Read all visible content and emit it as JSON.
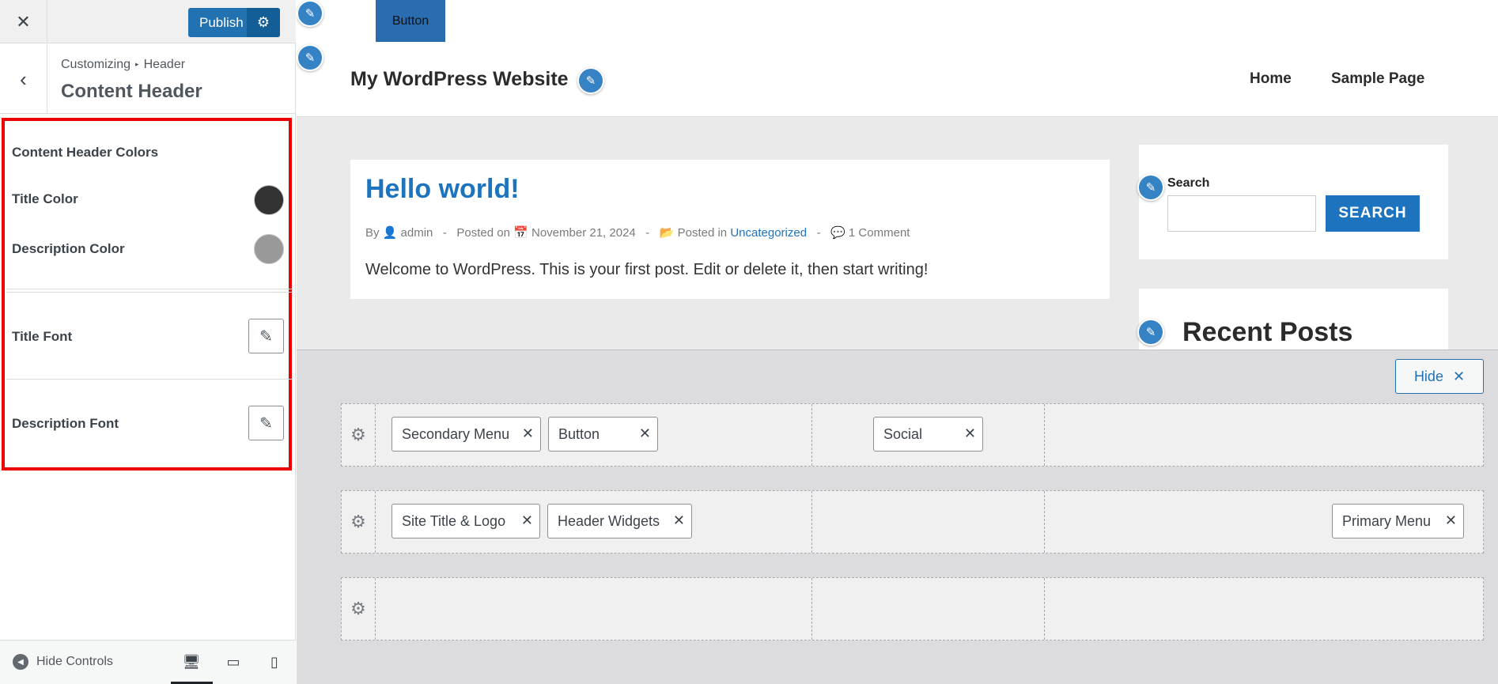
{
  "sidebar": {
    "close_icon": "close-icon",
    "publish_label": "Publish",
    "breadcrumb": {
      "root": "Customizing",
      "separator": "▸",
      "current": "Header"
    },
    "title": "Content Header",
    "section_title": "Content Header Colors",
    "controls": {
      "title_color_label": "Title Color",
      "title_color_value": "#333333",
      "description_color_label": "Description Color",
      "description_color_value": "#999999",
      "title_font_label": "Title Font",
      "description_font_label": "Description Font"
    },
    "footer": {
      "hide_controls_label": "Hide Controls",
      "devices": [
        "desktop",
        "tablet",
        "mobile"
      ],
      "active_device": "desktop"
    }
  },
  "preview": {
    "top_button_label": "Button",
    "site_title": "My WordPress Website",
    "nav": [
      "Home",
      "Sample Page"
    ],
    "post": {
      "title": "Hello world!",
      "meta": {
        "by": "By",
        "author": "admin",
        "posted_on": "Posted on",
        "date": "November 21, 2024",
        "posted_in": "Posted in",
        "category": "Uncategorized",
        "comments": "1 Comment"
      },
      "excerpt": "Welcome to WordPress. This is your first post. Edit or delete it, then start writing!"
    },
    "search_widget": {
      "label": "Search",
      "button_label": "SEARCH",
      "input_value": ""
    },
    "recent_posts_title": "Recent Posts"
  },
  "builder": {
    "hide_label": "Hide",
    "rows": [
      {
        "items_left": [
          "Secondary Menu",
          "Button"
        ],
        "items_center": [
          "Social"
        ],
        "items_right": []
      },
      {
        "items_left": [
          "Site Title & Logo",
          "Header Widgets"
        ],
        "items_center": [],
        "items_right": [
          "Primary Menu"
        ]
      },
      {
        "items_left": [],
        "items_center": [],
        "items_right": []
      }
    ]
  },
  "colors": {
    "accent": "#2271b1",
    "link": "#1e73be",
    "highlight_border": "#ee0000"
  }
}
